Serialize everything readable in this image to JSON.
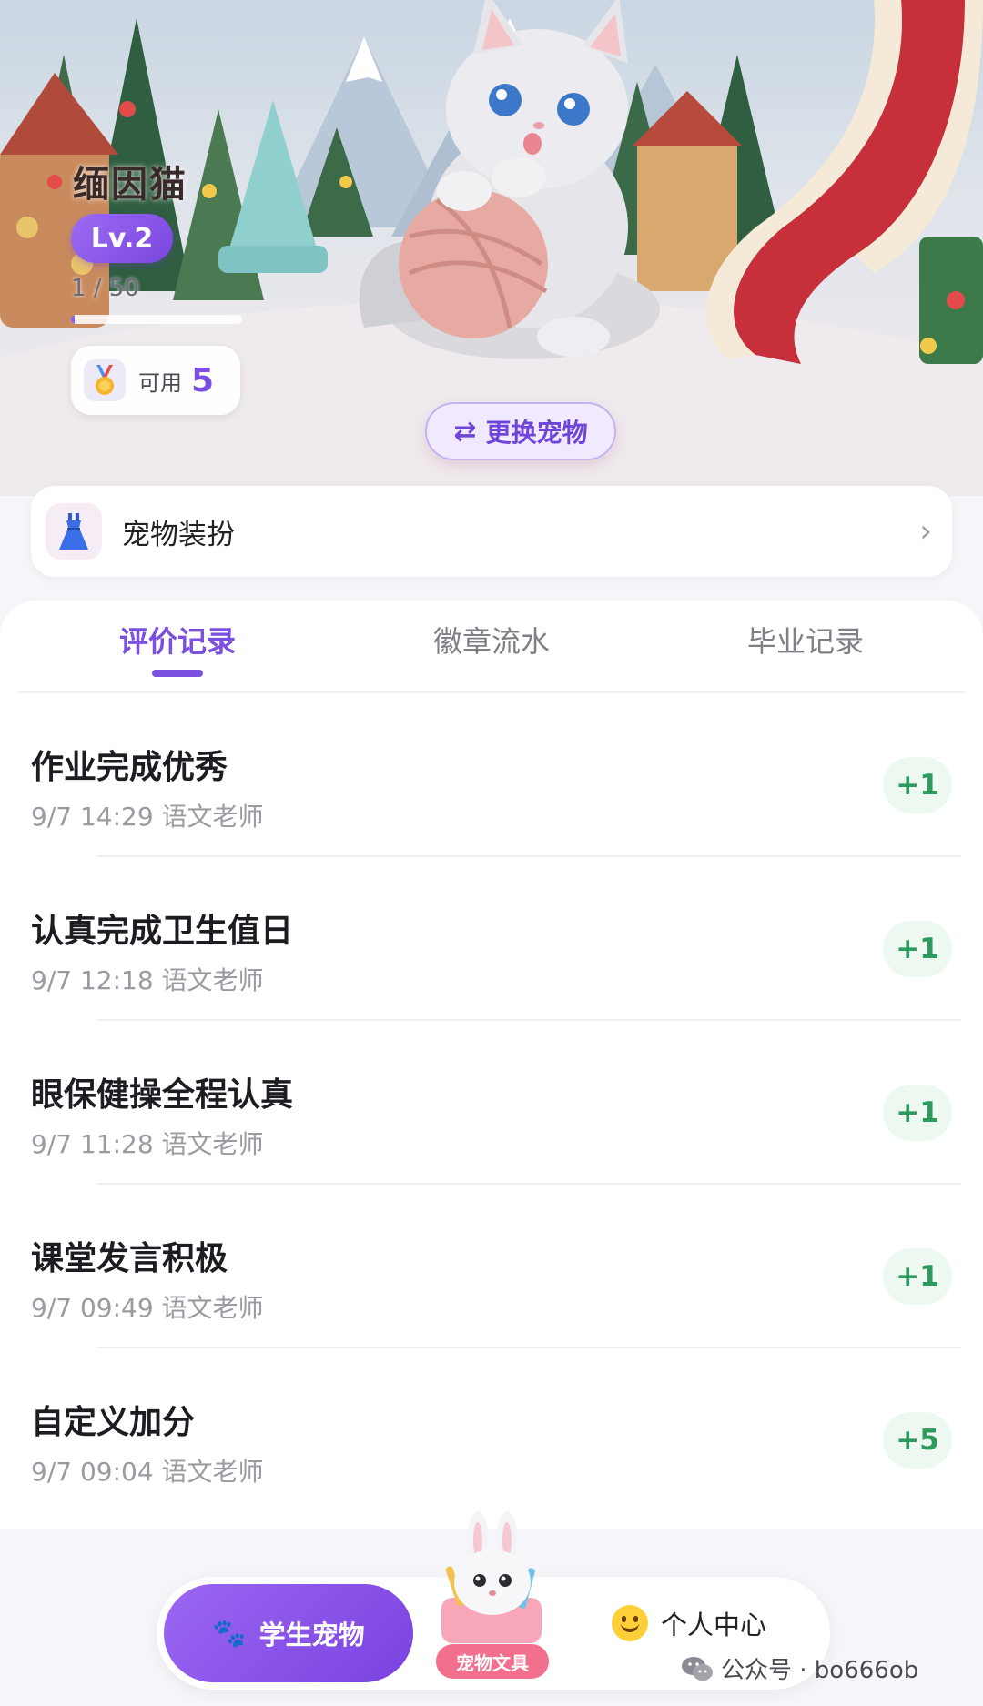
{
  "hero": {
    "pet_name": "缅因猫",
    "level": "Lv.2",
    "exp_text": "1 / 50",
    "exp_progress": 0.02,
    "coins_label": "可用",
    "coins_value": "5",
    "switch_button": "更换宠物",
    "switch_icon": "⇄",
    "medal_icon": "medal-icon"
  },
  "dress_up": {
    "label": "宠物装扮",
    "icon": "dress-icon",
    "chevron": "›"
  },
  "tabs": [
    {
      "label": "评价记录",
      "active": true
    },
    {
      "label": "徽章流水",
      "active": false
    },
    {
      "label": "毕业记录",
      "active": false
    }
  ],
  "records": [
    {
      "title": "作业完成优秀",
      "meta": "9/7 14:29 语文老师",
      "points": "+1"
    },
    {
      "title": "认真完成卫生值日",
      "meta": "9/7 12:18 语文老师",
      "points": "+1"
    },
    {
      "title": "眼保健操全程认真",
      "meta": "9/7 11:28 语文老师",
      "points": "+1"
    },
    {
      "title": "课堂发言积极",
      "meta": "9/7 09:49 语文老师",
      "points": "+1"
    },
    {
      "title": "自定义加分",
      "meta": "9/7 09:04 语文老师",
      "points": "+5"
    }
  ],
  "bottom_nav": {
    "pet_tab": "学生宠物",
    "pet_tab_icon": "🐾",
    "center_label": "宠物文具",
    "profile_tab": "个人中心"
  },
  "watermark": "公众号 · bo666ob",
  "colors": {
    "accent": "#7b4fe0",
    "points_green": "#2e9b5e",
    "points_bg": "#ecf8f0",
    "center_pink": "#f26f8e"
  }
}
